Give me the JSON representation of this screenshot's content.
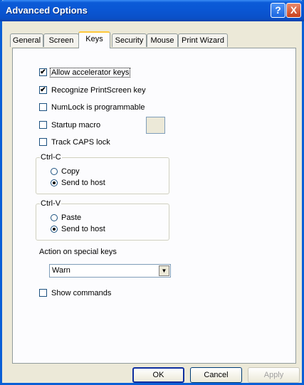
{
  "window": {
    "title": "Advanced Options",
    "help_icon": "?",
    "close_icon": "X"
  },
  "tabs": [
    {
      "label": "General"
    },
    {
      "label": "Screen"
    },
    {
      "label": "Keys",
      "active": true
    },
    {
      "label": "Security"
    },
    {
      "label": "Mouse"
    },
    {
      "label": "Print Wizard"
    }
  ],
  "options": {
    "allow_accelerator_keys": {
      "label": "Allow accelerator keys",
      "checked": true
    },
    "recognize_printscreen": {
      "label": "Recognize PrintScreen key",
      "checked": true
    },
    "numlock_programmable": {
      "label": "NumLock is programmable",
      "checked": false
    },
    "startup_macro": {
      "label": "Startup macro",
      "checked": false
    },
    "track_caps_lock": {
      "label": "Track CAPS lock",
      "checked": false
    },
    "show_commands": {
      "label": "Show commands",
      "checked": false
    }
  },
  "ctrl_c": {
    "title": "Ctrl-C",
    "copy": "Copy",
    "send_to_host": "Send to host",
    "selected": "send_to_host"
  },
  "ctrl_v": {
    "title": "Ctrl-V",
    "paste": "Paste",
    "send_to_host": "Send to host",
    "selected": "send_to_host"
  },
  "special_keys": {
    "label": "Action on special keys",
    "selected": "Warn",
    "arrow_icon": "▼"
  },
  "buttons": {
    "ok": "OK",
    "cancel": "Cancel",
    "apply": "Apply"
  },
  "check_mark": "✔"
}
